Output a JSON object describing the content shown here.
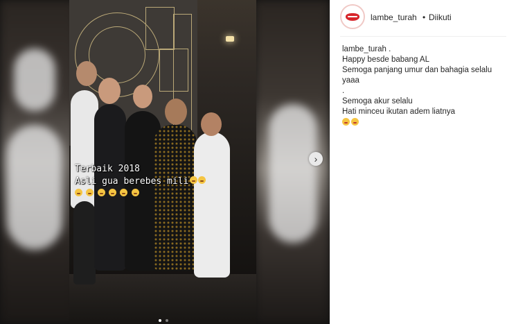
{
  "post": {
    "video_overlay_line1": "Terbaik 2018",
    "video_overlay_line2": "Asli gua berebes mili",
    "video_overlay_emoji_count": 6,
    "carousel_current": 1,
    "carousel_total": 2,
    "next_icon": "chevron-right-icon"
  },
  "header": {
    "username": "lambe_turah",
    "separator": "•",
    "status": "Diikuti"
  },
  "caption": {
    "username": "lambe_turah",
    "first_line_suffix": " .",
    "lines": [
      "Happy besde babang AL",
      "Semoga panjang umur dan bahagia selalu",
      "yaaa",
      ".",
      "Semoga akur selalu",
      "Hati minceu ikutan adem liatnya"
    ],
    "trailing_emoji_count": 2
  },
  "colors": {
    "brand_lips": "#d7262b",
    "text": "#262626",
    "divider": "#efefef"
  }
}
